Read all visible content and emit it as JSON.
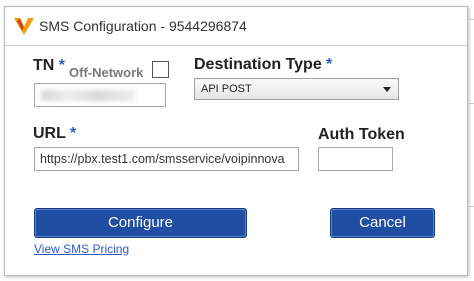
{
  "dialog": {
    "title": "SMS Configuration - 9544296874"
  },
  "form": {
    "tn_label": "TN",
    "tn_required_mark": "*",
    "off_network_label": "Off-Network",
    "off_network_checked": false,
    "tn_value": "",
    "destination_type_label": "Destination Type",
    "destination_type_required_mark": "*",
    "destination_type_selected": "API POST",
    "url_label": "URL",
    "url_required_mark": "*",
    "url_value": "https://pbx.test1.com/smsservice/voipinnova",
    "auth_token_label": "Auth Token",
    "auth_token_value": ""
  },
  "buttons": {
    "configure_label": "Configure",
    "cancel_label": "Cancel"
  },
  "links": {
    "sms_pricing_label": "View SMS Pricing"
  },
  "colors": {
    "button_blue": "#1f4ea3",
    "link_blue": "#2b5cc9",
    "logo_orange": "#f39c12"
  },
  "icons": {
    "logo": "v-logo-icon",
    "select_arrow": "chevron-down-icon"
  }
}
